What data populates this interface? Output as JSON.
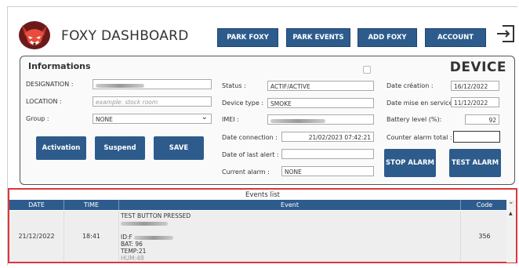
{
  "header": {
    "brand": "FOXY DASHBOARD",
    "nav": [
      "PARK FOXY",
      "PARK EVENTS",
      "ADD FOXY",
      "ACCOUNT"
    ]
  },
  "info": {
    "title": "Informations",
    "device_heading": "DEVICE",
    "designation_label": "DESIGNATION :",
    "location_label": "LOCATION :",
    "location_placeholder": "example: stock room",
    "group_label": "Group :",
    "group_value": "NONE",
    "status_label": "Status :",
    "status_value": "ACTIF/ACTIVE",
    "device_type_label": "Device type :",
    "device_type_value": "SMOKE",
    "imei_label": "IMEI :",
    "date_connection_label": "Date connection :",
    "date_connection_value": "21/02/2023 07:42:21",
    "date_last_alert_label": "Date of last alert :",
    "current_alarm_label": "Current alarm :",
    "current_alarm_value": "NONE",
    "date_creation_label": "Date création :",
    "date_creation_value": "16/12/2022",
    "date_service_label": "Date mise en service :",
    "date_service_value": "11/12/2022",
    "battery_label": "Battery level (%):",
    "battery_value": "92",
    "counter_label": "Counter alarm total :",
    "buttons": {
      "activation": "Activation",
      "suspend": "Suspend",
      "save": "SAVE",
      "stop_alarm": "STOP ALARM",
      "test_alarm": "TEST ALARM"
    }
  },
  "events": {
    "caption": "Events list",
    "columns": [
      "DATE",
      "TIME",
      "Event",
      "Code"
    ],
    "row": {
      "date": "21/12/2022",
      "time": "18:41",
      "event_title": "TEST BUTTON PRESSED",
      "event_id": "ID:F",
      "event_bat": "BAT: 96",
      "event_temp": "TEMP:21",
      "event_hum": "HUM:48",
      "code": "356"
    }
  },
  "colors": {
    "primary": "#2d5c8c",
    "highlight_border": "#d9383c"
  }
}
